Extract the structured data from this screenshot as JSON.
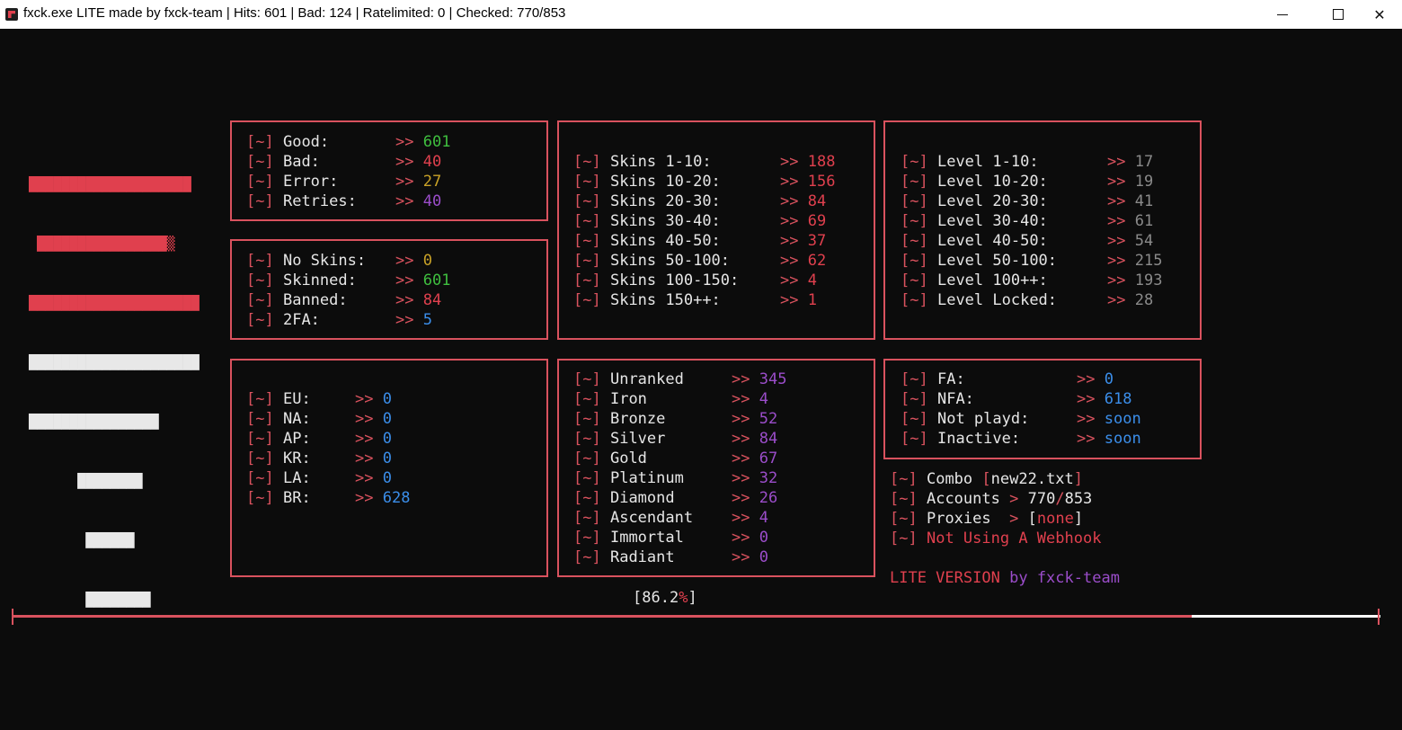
{
  "window": {
    "title": "fxck.exe LITE made by fxck-team | Hits: 601 | Bad: 124 | Ratelimited: 0 | Checked: 770/853",
    "minimize_glyph": "—",
    "maximize_glyph": "☐",
    "close_glyph": "✕"
  },
  "logo": {
    "rows": [
      "████████████████████",
      " ████████████████▒",
      "█████████████████████",
      "█████████████████████",
      "████████████████",
      "      ████████",
      "       ██████",
      "       ████████"
    ]
  },
  "bracket": "[~]",
  "arrow": ">>",
  "stats": [
    {
      "label": "Good:",
      "value": "601",
      "color": "green"
    },
    {
      "label": "Bad:",
      "value": "40",
      "color": "red"
    },
    {
      "label": "Error:",
      "value": "27",
      "color": "yellow"
    },
    {
      "label": "Retries:",
      "value": "40",
      "color": "purple"
    }
  ],
  "account_status": [
    {
      "label": "No Skins:",
      "value": "0",
      "color": "yellow"
    },
    {
      "label": "Skinned:",
      "value": "601",
      "color": "green"
    },
    {
      "label": "Banned:",
      "value": "84",
      "color": "red"
    },
    {
      "label": "2FA:",
      "value": "5",
      "color": "blue"
    }
  ],
  "skins": [
    {
      "label": "Skins 1-10:",
      "value": "188"
    },
    {
      "label": "Skins 10-20:",
      "value": "156"
    },
    {
      "label": "Skins 20-30:",
      "value": "84"
    },
    {
      "label": "Skins 30-40:",
      "value": "69"
    },
    {
      "label": "Skins 40-50:",
      "value": "37"
    },
    {
      "label": "Skins 50-100:",
      "value": "62"
    },
    {
      "label": "Skins 100-150:",
      "value": "4"
    },
    {
      "label": "Skins 150++:",
      "value": "1"
    }
  ],
  "levels": [
    {
      "label": "Level 1-10:",
      "value": "17"
    },
    {
      "label": "Level 10-20:",
      "value": "19"
    },
    {
      "label": "Level 20-30:",
      "value": "41"
    },
    {
      "label": "Level 30-40:",
      "value": "61"
    },
    {
      "label": "Level 40-50:",
      "value": "54"
    },
    {
      "label": "Level 50-100:",
      "value": "215"
    },
    {
      "label": "Level 100++:",
      "value": "193"
    },
    {
      "label": "Level Locked:",
      "value": "28"
    }
  ],
  "regions": [
    {
      "label": "EU:",
      "value": "0"
    },
    {
      "label": "NA:",
      "value": "0"
    },
    {
      "label": "AP:",
      "value": "0"
    },
    {
      "label": "KR:",
      "value": "0"
    },
    {
      "label": "LA:",
      "value": "0"
    },
    {
      "label": "BR:",
      "value": "628"
    }
  ],
  "ranks": [
    {
      "label": "Unranked",
      "value": "345"
    },
    {
      "label": "Iron",
      "value": "4"
    },
    {
      "label": "Bronze",
      "value": "52"
    },
    {
      "label": "Silver",
      "value": "84"
    },
    {
      "label": "Gold",
      "value": "67"
    },
    {
      "label": "Platinum",
      "value": "32"
    },
    {
      "label": "Diamond",
      "value": "26"
    },
    {
      "label": "Ascendant",
      "value": "4"
    },
    {
      "label": "Immortal",
      "value": "0"
    },
    {
      "label": "Radiant",
      "value": "0"
    }
  ],
  "access": [
    {
      "label": "FA:",
      "value": "0"
    },
    {
      "label": "NFA:",
      "value": "618"
    },
    {
      "label": "Not playd:",
      "value": "soon"
    },
    {
      "label": "Inactive:",
      "value": "soon"
    }
  ],
  "info": {
    "combo_label": "Combo",
    "combo_file": "new22.txt",
    "accounts_label": "Accounts",
    "accounts_checked": "770",
    "accounts_total": "853",
    "proxies_label": "Proxies",
    "proxies_value": "none",
    "webhook_text": "Not Using A Webhook",
    "version_a": "LITE VERSION",
    "version_b": "by",
    "version_c": "fxck-team"
  },
  "progress": {
    "percent": "86.2",
    "percent_sign": "%",
    "fraction": 0.862
  },
  "colors": {
    "accent": "#d9525e",
    "green": "#3fbf3f",
    "red": "#e0404e",
    "yellow": "#c9a227",
    "purple": "#9b4dca",
    "blue": "#3b8eea",
    "grey": "#8a8a8a"
  }
}
